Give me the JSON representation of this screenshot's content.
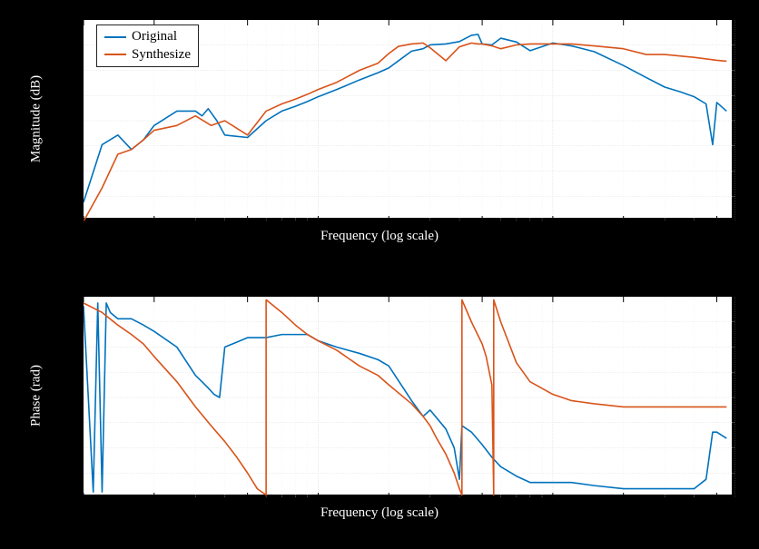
{
  "colors": {
    "original": "#0072bd",
    "synthesize": "#d95319",
    "grid": "#dddddd",
    "gridminor": "#eeeeee",
    "axis": "#000000"
  },
  "legend": {
    "items": [
      {
        "name": "Original",
        "color": "#0072bd"
      },
      {
        "name": "Synthesize",
        "color": "#d95319"
      }
    ]
  },
  "chart_data": [
    {
      "type": "line",
      "title": "",
      "xlabel": "Frequency (log scale)",
      "ylabel": "Magnitude (dB)",
      "xscale": "log",
      "xlim": [
        100,
        60000
      ],
      "ylim": [
        -40,
        2
      ],
      "xticks": [
        100,
        200,
        500,
        1000,
        2000,
        5000,
        10000,
        20000,
        50000
      ],
      "yticks": [
        -40,
        -35,
        -30,
        -25,
        -20,
        -15,
        -10,
        -5,
        0
      ],
      "series": [
        {
          "name": "Original",
          "color": "#0072bd",
          "x": [
            100,
            120,
            140,
            160,
            180,
            200,
            250,
            300,
            320,
            340,
            370,
            400,
            500,
            600,
            700,
            800,
            900,
            1000,
            1200,
            1500,
            1800,
            2000,
            2200,
            2500,
            2800,
            3000,
            3500,
            4000,
            4500,
            4800,
            5000,
            5500,
            6000,
            7000,
            8000,
            10000,
            12000,
            15000,
            20000,
            25000,
            30000,
            35000,
            40000,
            45000,
            48000,
            50000,
            55000
          ],
          "y": [
            -36,
            -24,
            -22,
            -25,
            -23,
            -20,
            -17,
            -17,
            -18,
            -16.5,
            -19,
            -22,
            -22.5,
            -19,
            -17,
            -16,
            -15,
            -14,
            -12.5,
            -10.5,
            -9,
            -8,
            -6.5,
            -4.5,
            -4,
            -3.2,
            -3,
            -2.5,
            -1.2,
            -1,
            -3,
            -3.2,
            -1.8,
            -2.6,
            -4.4,
            -2.8,
            -3.4,
            -4.6,
            -7.5,
            -10,
            -12,
            -13,
            -14,
            -15.5,
            -24,
            -15.2,
            -17
          ]
        },
        {
          "name": "Synthesize",
          "color": "#d95319",
          "x": [
            100,
            120,
            140,
            160,
            180,
            200,
            250,
            300,
            350,
            400,
            500,
            600,
            700,
            800,
            900,
            1000,
            1200,
            1500,
            1800,
            2000,
            2200,
            2500,
            2800,
            3000,
            3500,
            4000,
            4500,
            4800,
            5000,
            5500,
            6000,
            7000,
            8000,
            10000,
            12000,
            15000,
            20000,
            25000,
            30000,
            40000,
            50000,
            55000
          ],
          "y": [
            -40,
            -33,
            -26,
            -25,
            -23,
            -21,
            -20,
            -18,
            -20,
            -19,
            -22,
            -17,
            -15.5,
            -14.5,
            -13.5,
            -12.5,
            -11,
            -8.5,
            -7,
            -5,
            -3.5,
            -3,
            -2.8,
            -3.8,
            -6.5,
            -3.6,
            -2.8,
            -3,
            -3,
            -3.4,
            -4,
            -3.2,
            -3,
            -3,
            -3,
            -3.4,
            -4,
            -5.2,
            -5.2,
            -5.8,
            -6.4,
            -6.6
          ]
        }
      ]
    },
    {
      "type": "line",
      "title": "",
      "xlabel": "Frequency (log scale)",
      "ylabel": "Phase (rad)",
      "xscale": "log",
      "xlim": [
        100,
        60000
      ],
      "ylim": [
        -3.2,
        3.2
      ],
      "xticks": [
        100,
        200,
        500,
        1000,
        2000,
        5000,
        10000,
        20000,
        50000
      ],
      "yticks": [
        -3.14,
        -1.57,
        0,
        1.57,
        3.14
      ],
      "series": [
        {
          "name": "Original",
          "color": "#0072bd",
          "x": [
            100,
            110,
            115,
            120,
            125,
            130,
            140,
            160,
            180,
            200,
            250,
            300,
            320,
            340,
            360,
            380,
            400,
            500,
            600,
            700,
            800,
            900,
            1000,
            1200,
            1500,
            1800,
            2000,
            2500,
            2800,
            3000,
            3500,
            3800,
            4000,
            4100,
            4500,
            5000,
            5500,
            6000,
            7000,
            8000,
            10000,
            12000,
            15000,
            20000,
            25000,
            30000,
            35000,
            40000,
            45000,
            48000,
            50000,
            55000
          ],
          "y": [
            2.9,
            -3,
            3,
            -3,
            3,
            2.7,
            2.5,
            2.5,
            2.3,
            2.1,
            1.6,
            0.7,
            0.5,
            0.3,
            0.1,
            0,
            1.6,
            1.9,
            1.9,
            2,
            2,
            2,
            1.8,
            1.6,
            1.4,
            1.2,
            1,
            -0.1,
            -0.6,
            -0.4,
            -1,
            -1.6,
            -2.6,
            -0.9,
            -1.1,
            -1.5,
            -1.9,
            -2.2,
            -2.5,
            -2.7,
            -2.7,
            -2.7,
            -2.8,
            -2.9,
            -2.9,
            -2.9,
            -2.9,
            -2.9,
            -2.6,
            -1.1,
            -1.1,
            -1.3
          ]
        },
        {
          "name": "Synthesize",
          "color": "#d95319",
          "x": [
            100,
            120,
            140,
            160,
            180,
            200,
            250,
            300,
            350,
            400,
            450,
            500,
            550,
            600,
            601,
            700,
            800,
            900,
            1000,
            1200,
            1500,
            1800,
            2000,
            2500,
            2800,
            3000,
            3200,
            3500,
            3800,
            4000,
            4100,
            4101,
            4500,
            5000,
            5200,
            5500,
            5600,
            5601,
            6000,
            7000,
            8000,
            10000,
            12000,
            15000,
            20000,
            30000,
            40000,
            50000,
            55000
          ],
          "y": [
            3,
            2.7,
            2.3,
            2,
            1.7,
            1.3,
            0.5,
            -0.3,
            -0.9,
            -1.4,
            -1.9,
            -2.4,
            -2.9,
            -3.1,
            3.1,
            2.7,
            2.3,
            2,
            1.8,
            1.5,
            1,
            0.7,
            0.4,
            -0.2,
            -0.6,
            -0.9,
            -1.3,
            -1.8,
            -2.4,
            -2.9,
            -3.1,
            3.1,
            2.4,
            1.7,
            1.3,
            0.4,
            -3.1,
            3.1,
            2.4,
            1.1,
            0.5,
            0.1,
            -0.1,
            -0.2,
            -0.3,
            -0.3,
            -0.3,
            -0.3,
            -0.3
          ]
        }
      ]
    }
  ]
}
